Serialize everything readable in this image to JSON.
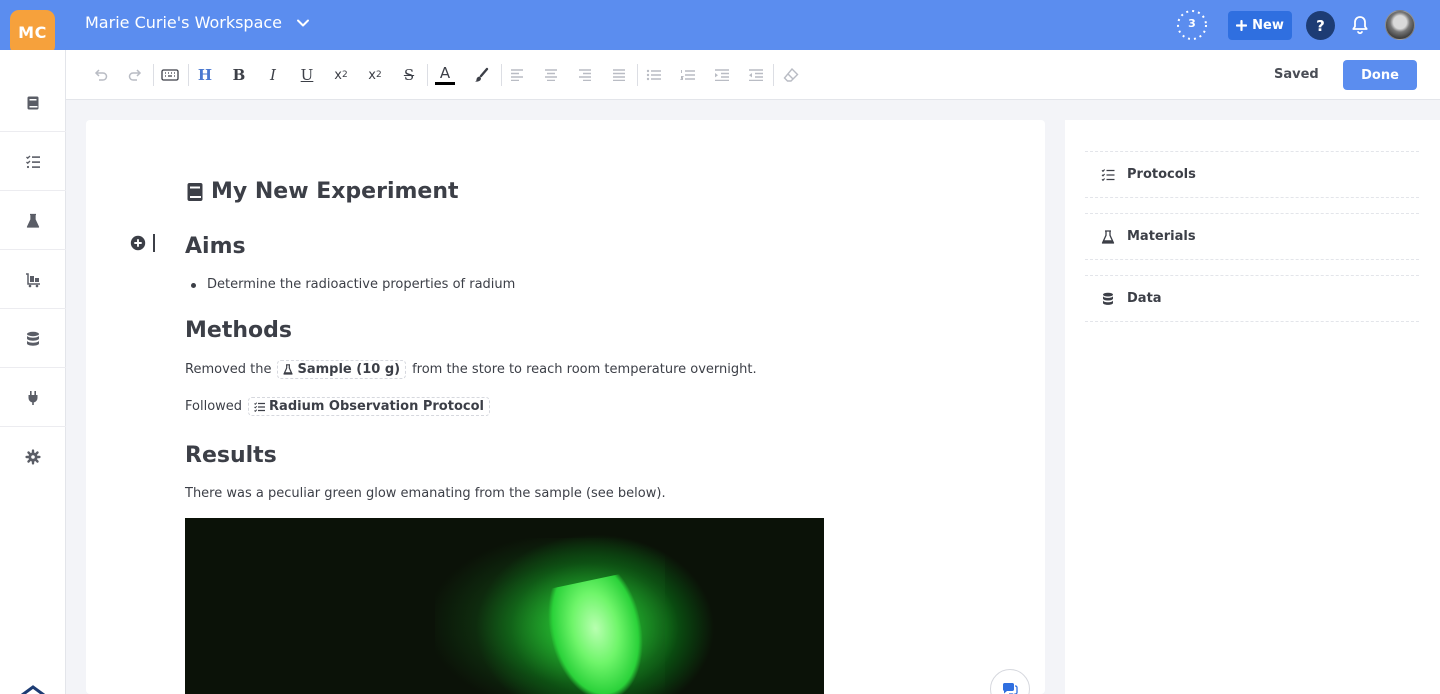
{
  "topbar": {
    "logo_initials": "MC",
    "workspace_name": "Marie Curie's Workspace",
    "sync_count": "3",
    "new_label": "New",
    "help_label": "?",
    "colors": {
      "bar": "#5b8def",
      "logo": "#f6a13c",
      "new_button": "#2f6fe0",
      "help_button": "#1d3c74"
    }
  },
  "sidebar": {
    "items": [
      {
        "icon": "book-icon"
      },
      {
        "icon": "checklist-icon"
      },
      {
        "icon": "flask-icon"
      },
      {
        "icon": "dolly-icon"
      },
      {
        "icon": "database-icon"
      },
      {
        "icon": "plug-icon"
      },
      {
        "icon": "gear-icon"
      }
    ]
  },
  "toolbar": {
    "buttons": [
      "undo-icon",
      "redo-icon",
      "keyboard-icon",
      "heading-icon",
      "bold-icon",
      "italic-icon",
      "underline-icon",
      "subscript-icon",
      "superscript-icon",
      "strikethrough-icon",
      "text-color-icon",
      "highlight-brush-icon",
      "align-left-icon",
      "align-center-icon",
      "align-right-icon",
      "align-justify-icon",
      "bullet-list-icon",
      "numbered-list-icon",
      "indent-icon",
      "outdent-icon",
      "clear-format-icon"
    ],
    "saved_label": "Saved",
    "done_label": "Done"
  },
  "document": {
    "title": "My New Experiment",
    "sections": {
      "aims": {
        "heading": "Aims",
        "bullets": [
          "Determine the radioactive properties of radium"
        ]
      },
      "methods": {
        "heading": "Methods",
        "line1": {
          "before": "Removed the",
          "chip": "Sample (10 g)",
          "after": "from the store to reach room temperature overnight."
        },
        "line2": {
          "before": "Followed",
          "chip": "Radium Observation Protocol"
        }
      },
      "results": {
        "heading": "Results",
        "text": "There was a peculiar green glow emanating from the sample (see below)."
      }
    }
  },
  "right_panel": {
    "cards": [
      {
        "label": "Protocols",
        "icon": "checklist-icon"
      },
      {
        "label": "Materials",
        "icon": "flask-icon"
      },
      {
        "label": "Data",
        "icon": "database-icon"
      }
    ]
  }
}
